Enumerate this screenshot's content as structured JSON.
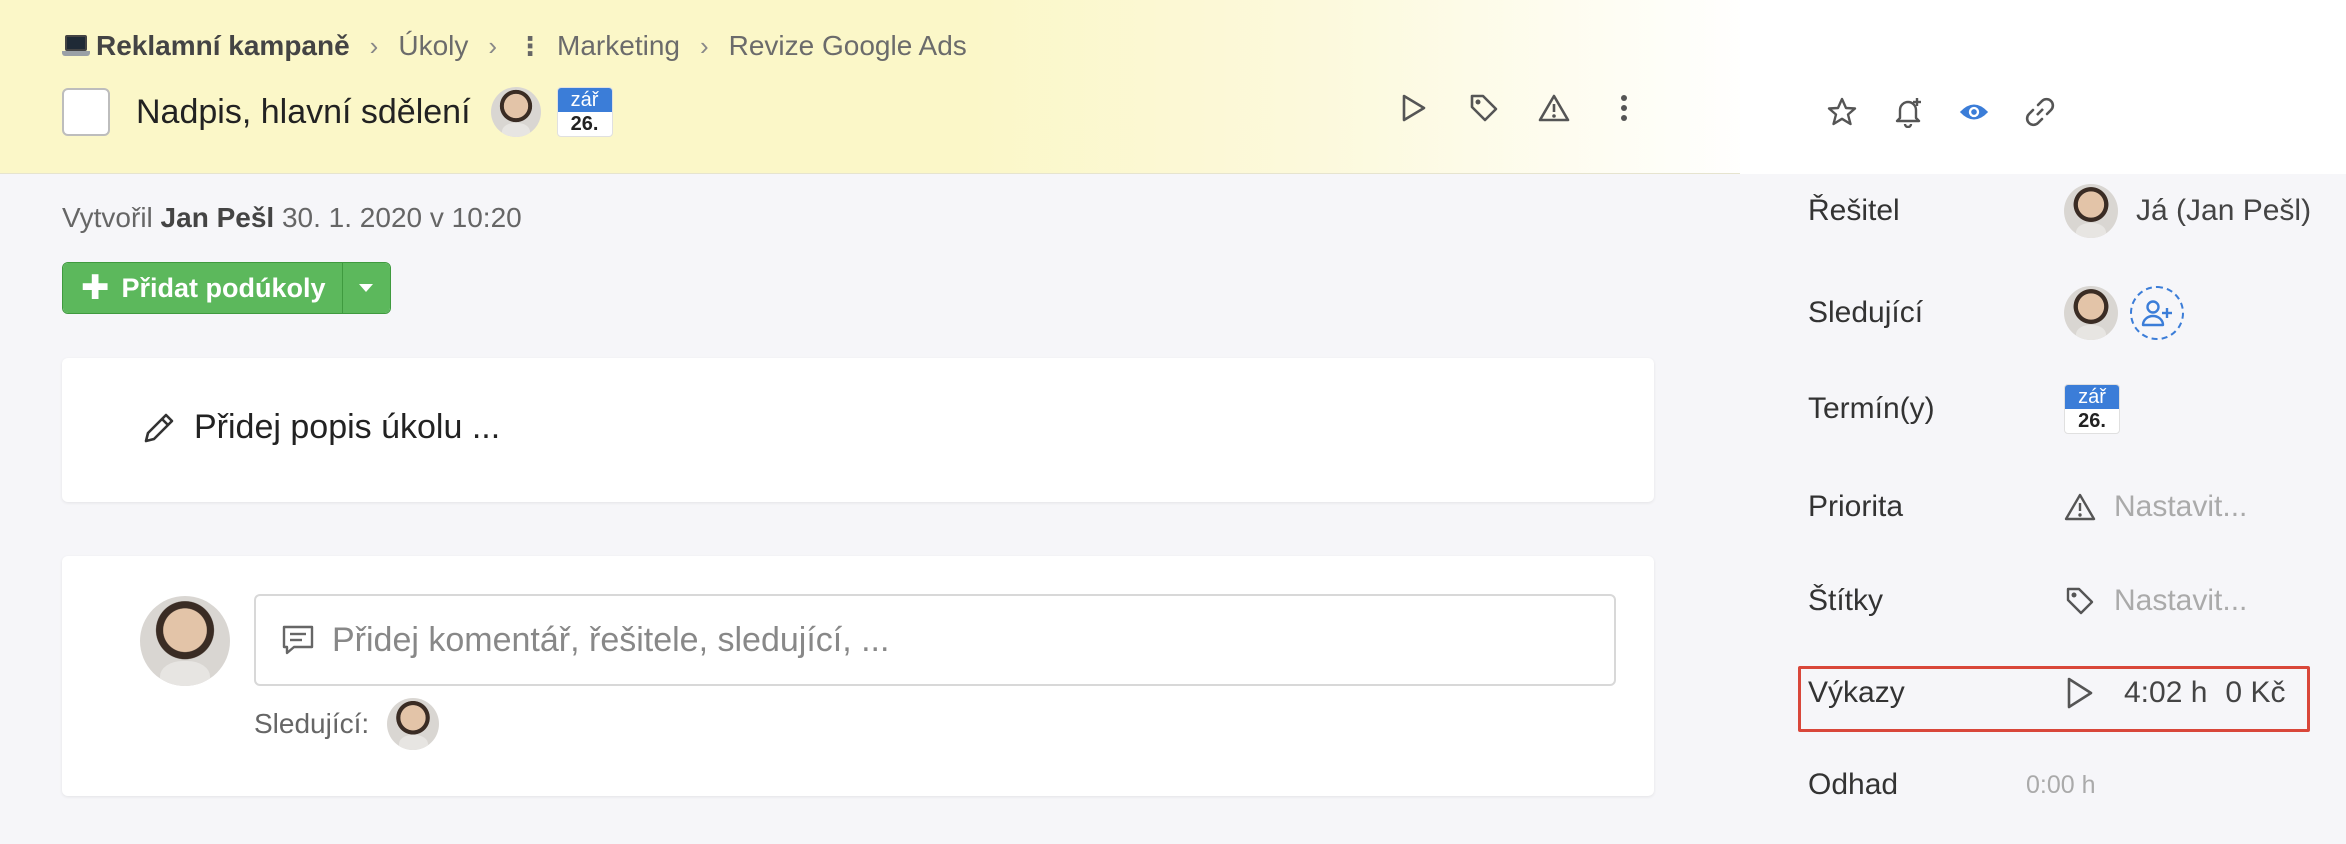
{
  "breadcrumb": {
    "root": "Reklamní kampaně",
    "items": [
      "Úkoly",
      "Marketing",
      "Revize Google Ads"
    ],
    "root_icon": "laptop-icon"
  },
  "task": {
    "title": "Nadpis, hlavní sdělení",
    "due_month": "zář",
    "due_day": "26."
  },
  "toolbar": {
    "icons": [
      "play-icon",
      "tag-icon",
      "warning-icon",
      "more-vertical-icon"
    ],
    "right_icons": [
      "star-icon",
      "bell-add-icon",
      "eye-icon",
      "link-icon"
    ]
  },
  "meta": {
    "created_prefix": "Vytvořil",
    "created_by": "Jan Pešl",
    "created_at": "30. 1. 2020 v 10:20"
  },
  "subtasks": {
    "add_label": "Přidat podúkoly"
  },
  "description": {
    "placeholder": "Přidej popis úkolu ..."
  },
  "comment": {
    "placeholder": "Přidej komentář, řešitele, sledující, ...",
    "followers_label": "Sledující:"
  },
  "sidebar": {
    "assignee_label": "Řešitel",
    "assignee_value": "Já (Jan Pešl)",
    "followers_label": "Sledující",
    "deadline_label": "Termín(y)",
    "deadline_month": "zář",
    "deadline_day": "26.",
    "priority_label": "Priorita",
    "priority_value": "Nastavit...",
    "tags_label": "Štítky",
    "tags_value": "Nastavit...",
    "reports_label": "Výkazy",
    "reports_time": "4:02 h",
    "reports_cost": "0 Kč",
    "estimate_label": "Odhad",
    "estimate_value": "0:00 h"
  },
  "colors": {
    "header_bg": "#fbf7c8",
    "accent_blue": "#3b7dd8",
    "green_button": "#5cb85c",
    "highlight_red": "#d9473a"
  }
}
